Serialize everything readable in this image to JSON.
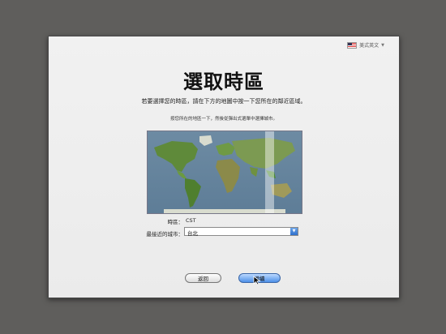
{
  "language_menu": {
    "label": "美式英文"
  },
  "header": {
    "title": "選取時區"
  },
  "instructions": {
    "primary": "若要選擇您的時區，請在下方的地圖中按一下您所在的鄰近區域。",
    "secondary": "按您所在的地區一下，然後從彈出式選單中選擇城市。"
  },
  "timezone": {
    "label": "時區：",
    "value": "CST"
  },
  "closest_city": {
    "label": "最接近的城市：",
    "value": "台北"
  },
  "buttons": {
    "back": "返回",
    "continue": "繼續"
  },
  "colors": {
    "background": "#5f5e5c",
    "accent": "#4d90e8",
    "ocean": "#6d8ba3",
    "land": "#5f8a3a"
  }
}
